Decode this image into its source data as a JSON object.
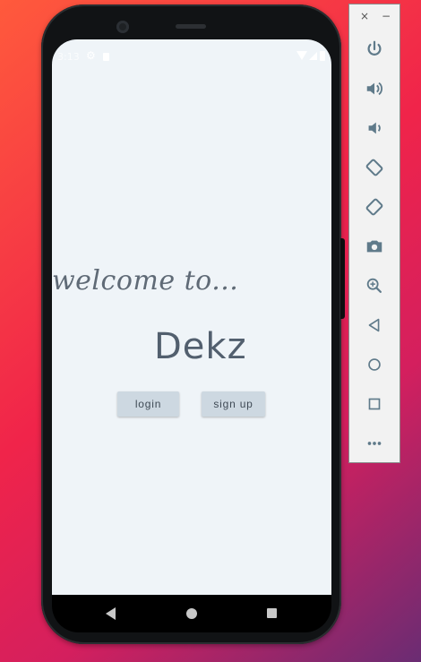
{
  "status_bar": {
    "time": "3:13",
    "gear_glyph": "⚙"
  },
  "app": {
    "welcome_text": "welcome to...",
    "brand_name": "Dekz",
    "login_label": "login",
    "signup_label": "sign up"
  },
  "toolbar": {
    "close_glyph": "×",
    "minimize_glyph": "−",
    "buttons": [
      {
        "name": "power-icon"
      },
      {
        "name": "volume-up-icon"
      },
      {
        "name": "volume-down-icon"
      },
      {
        "name": "rotate-left-icon"
      },
      {
        "name": "rotate-right-icon"
      },
      {
        "name": "camera-icon"
      },
      {
        "name": "zoom-icon"
      },
      {
        "name": "back-icon"
      },
      {
        "name": "home-icon"
      },
      {
        "name": "overview-icon"
      },
      {
        "name": "more-icon"
      }
    ]
  },
  "colors": {
    "screen_bg": "#eff4f8",
    "button_bg": "#cdd8e1",
    "brand_text": "#525f6e",
    "toolbar_icon": "#5f7a8a"
  }
}
